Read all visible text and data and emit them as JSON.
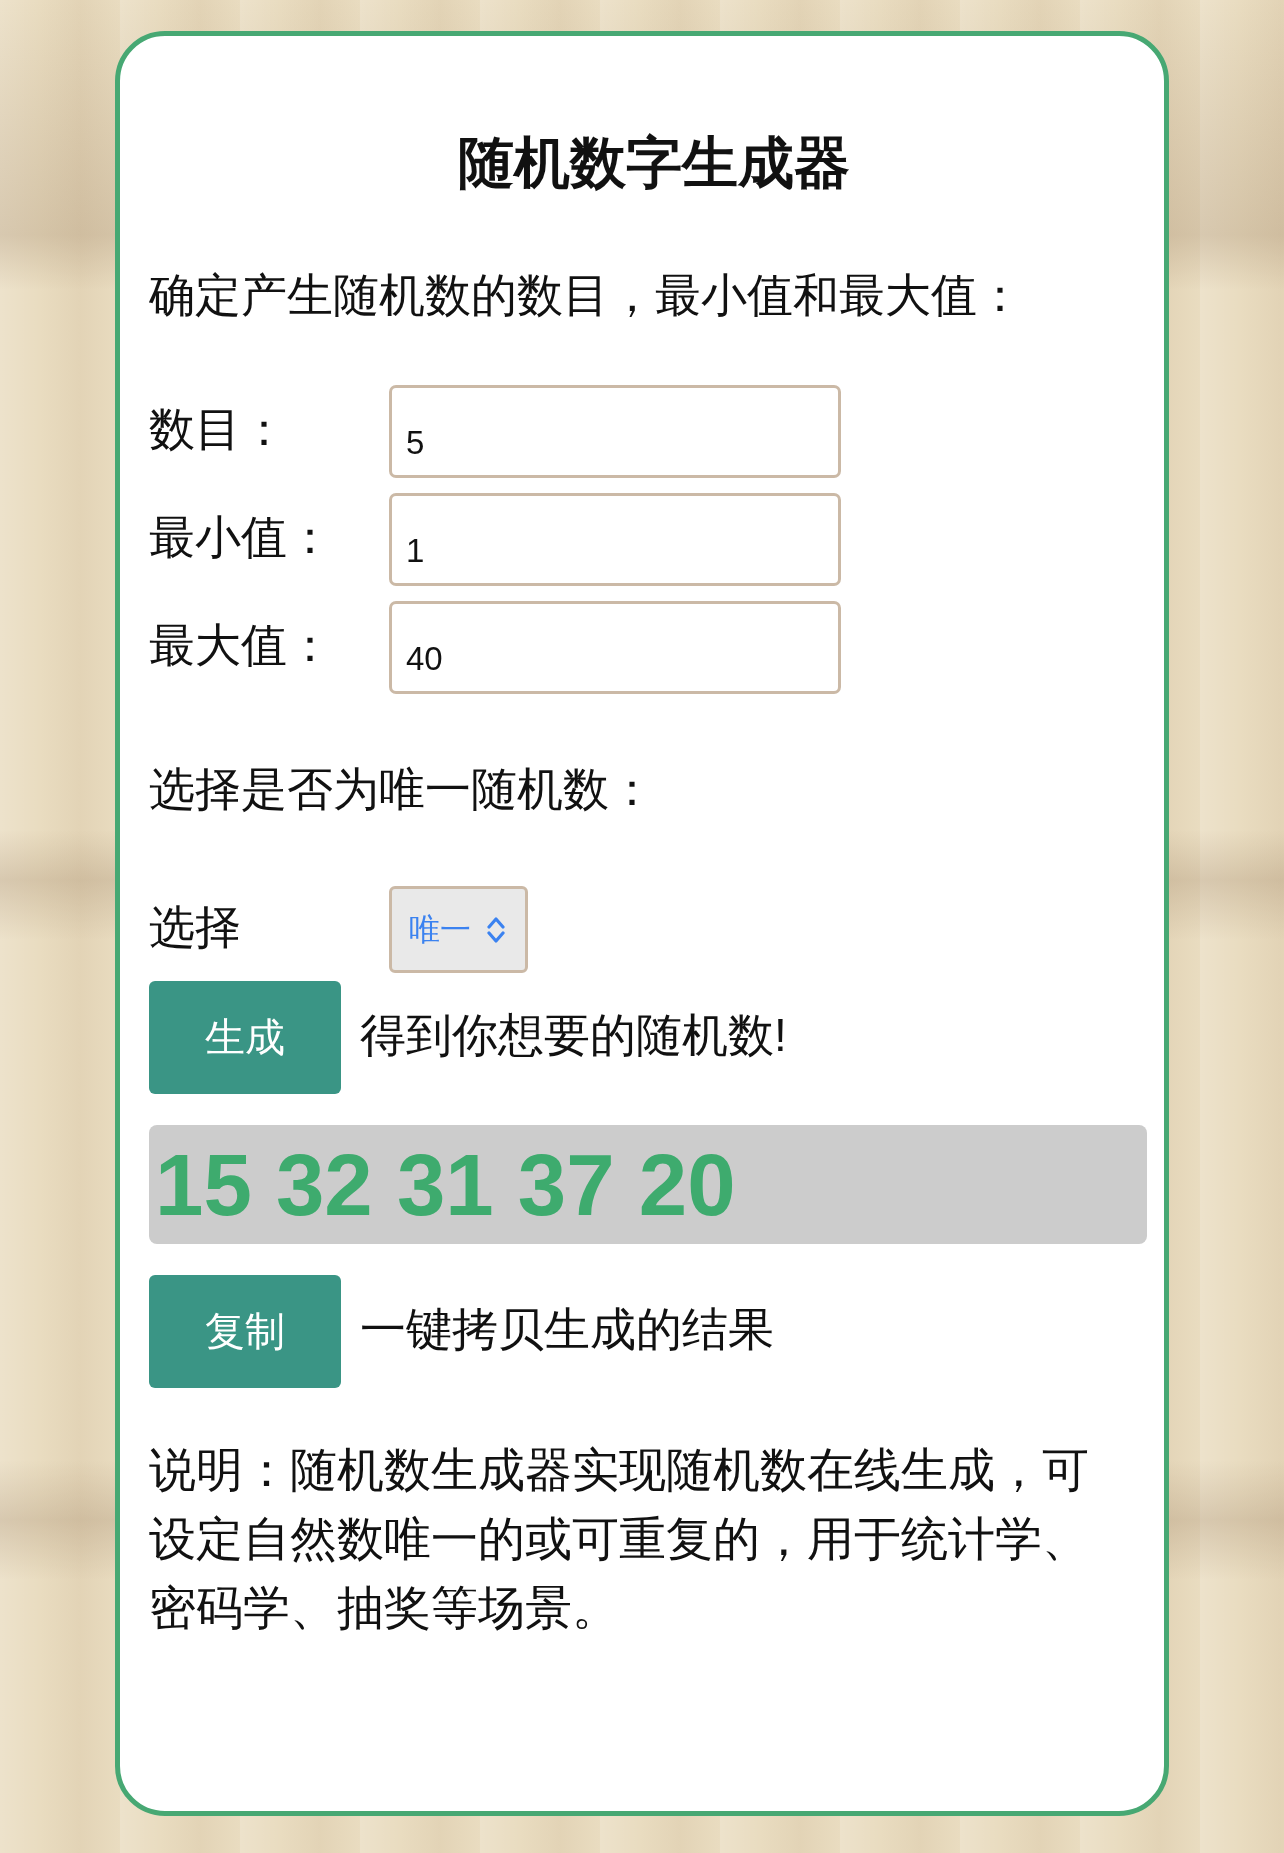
{
  "title": "随机数字生成器",
  "intro": "确定产生随机数的数目，最小值和最大值：",
  "fields": [
    {
      "label": "数目：",
      "value": "5"
    },
    {
      "label": "最小值：",
      "value": "1"
    },
    {
      "label": "最大值：",
      "value": "40"
    }
  ],
  "uniqueness": {
    "question": "选择是否为唯一随机数：",
    "label": "选择",
    "value": "唯一"
  },
  "generate": {
    "button": "生成",
    "hint": "得到你想要的随机数!"
  },
  "result": "15 32 31 37 20",
  "copy": {
    "button": "复制",
    "hint": "一键拷贝生成的结果"
  },
  "description": "说明：随机数生成器实现随机数在线生成，可设定自然数唯一的或可重复的，用于统计学、密码学、抽奖等场景。"
}
